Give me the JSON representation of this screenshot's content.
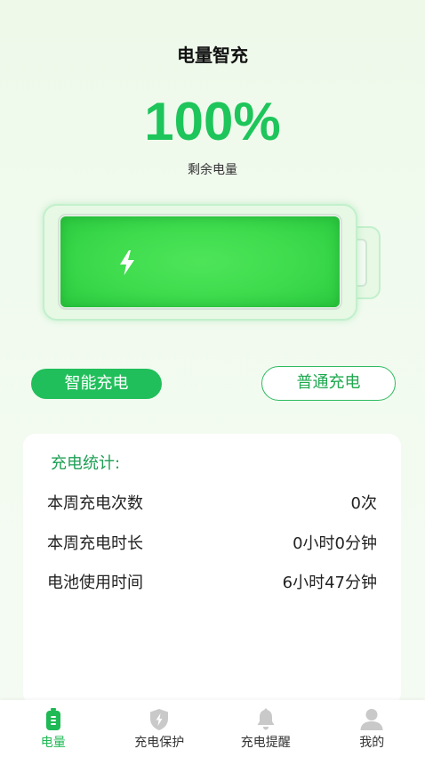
{
  "header": {
    "title": "电量智充"
  },
  "battery": {
    "percent_label": "100%",
    "caption": "剩余电量",
    "level": 1.0
  },
  "modes": {
    "smart": {
      "label": "智能充电",
      "selected": true
    },
    "normal": {
      "label": "普通充电",
      "selected": false
    }
  },
  "stats": {
    "title": "充电统计:",
    "rows": [
      {
        "label": "本周充电次数",
        "value": "0次"
      },
      {
        "label": "本周充电时长",
        "value": "0小时0分钟"
      },
      {
        "label": "电池使用时间",
        "value": "6小时47分钟"
      }
    ]
  },
  "tabbar": {
    "items": [
      {
        "label": "电量",
        "icon": "battery-icon",
        "active": true
      },
      {
        "label": "充电保护",
        "icon": "shield-bolt-icon",
        "active": false
      },
      {
        "label": "充电提醒",
        "icon": "bell-icon",
        "active": false
      },
      {
        "label": "我的",
        "icon": "person-icon",
        "active": false
      }
    ]
  },
  "colors": {
    "accent": "#21bf5b",
    "tab_active": "#1fb955",
    "inactive_icon": "#c9c9c9"
  }
}
